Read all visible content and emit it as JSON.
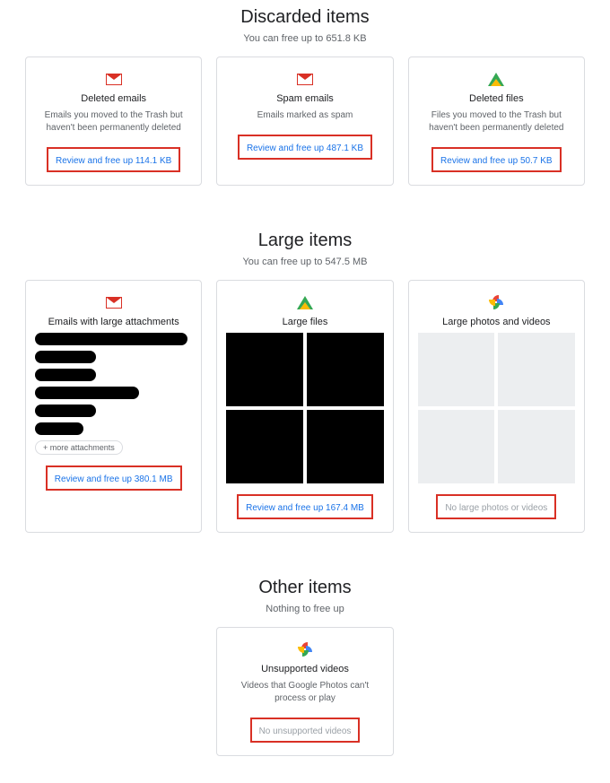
{
  "sections": {
    "discarded": {
      "title": "Discarded items",
      "subtitle": "You can free up to 651.8 KB"
    },
    "large": {
      "title": "Large items",
      "subtitle": "You can free up to 547.5 MB"
    },
    "other": {
      "title": "Other items",
      "subtitle": "Nothing to free up"
    }
  },
  "cards": {
    "deleted_emails": {
      "title": "Deleted emails",
      "desc": "Emails you moved to the Trash but haven't been permanently deleted",
      "action": "Review and free up 114.1 KB"
    },
    "spam_emails": {
      "title": "Spam emails",
      "desc": "Emails marked as spam",
      "action": "Review and free up 487.1 KB"
    },
    "deleted_files": {
      "title": "Deleted files",
      "desc": "Files you moved to the Trash but haven't been permanently deleted",
      "action": "Review and free up 50.7 KB"
    },
    "emails_large_attachments": {
      "title": "Emails with large attachments",
      "action": "Review and free up 380.1 MB",
      "more_chip": "+ more attachments"
    },
    "large_files": {
      "title": "Large files",
      "action": "Review and free up 167.4 MB"
    },
    "large_photos": {
      "title": "Large photos and videos",
      "action": "No large photos or videos"
    },
    "unsupported_videos": {
      "title": "Unsupported videos",
      "desc": "Videos that Google Photos can't process or play",
      "action": "No unsupported videos"
    }
  }
}
